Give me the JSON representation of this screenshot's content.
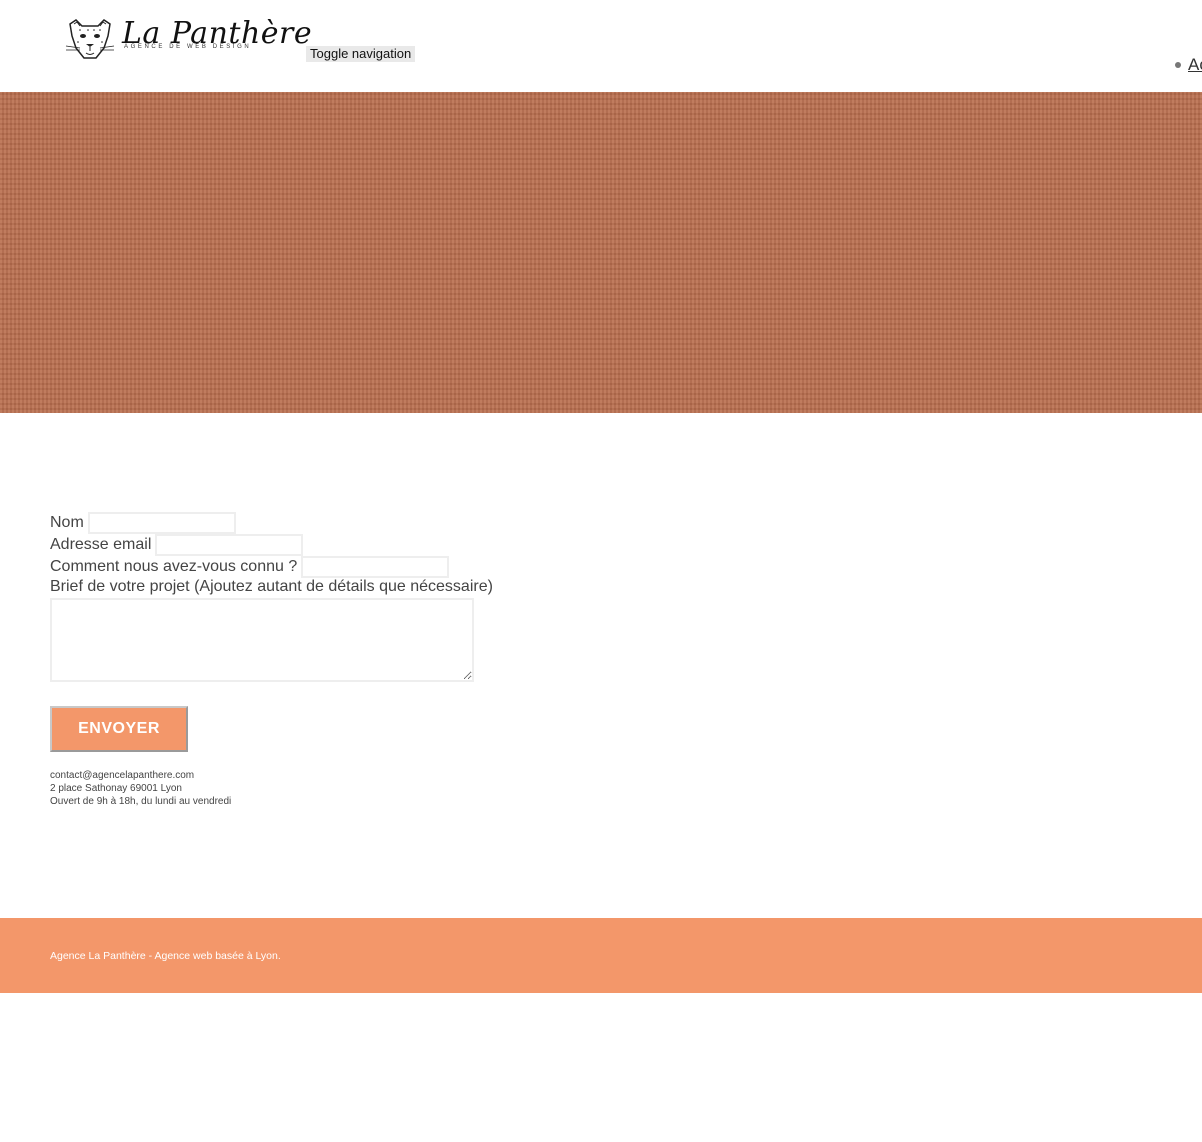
{
  "header": {
    "logo": {
      "title": "La Panthère",
      "subtitle": "AGENCE DE WEB DESIGN"
    },
    "toggle_label": "Toggle navigation",
    "nav_items": [
      {
        "label": "Ac"
      }
    ]
  },
  "form": {
    "name_label": "Nom",
    "email_label": "Adresse email",
    "source_label": "Comment nous avez-vous connu ?",
    "brief_label": "Brief de votre projet (Ajoutez autant de détails que nécessaire)",
    "submit_label": "ENVOYER"
  },
  "contact": {
    "email": "contact@agencelapanthere.com",
    "address": "2 place Sathonay 69001 Lyon",
    "hours": "Ouvert de 9h à 18h, du lundi au vendredi"
  },
  "footer": {
    "text": "Agence La Panthère - Agence web basée à Lyon."
  },
  "colors": {
    "banner": "#ba6f4f",
    "accent": "#f3976a"
  }
}
